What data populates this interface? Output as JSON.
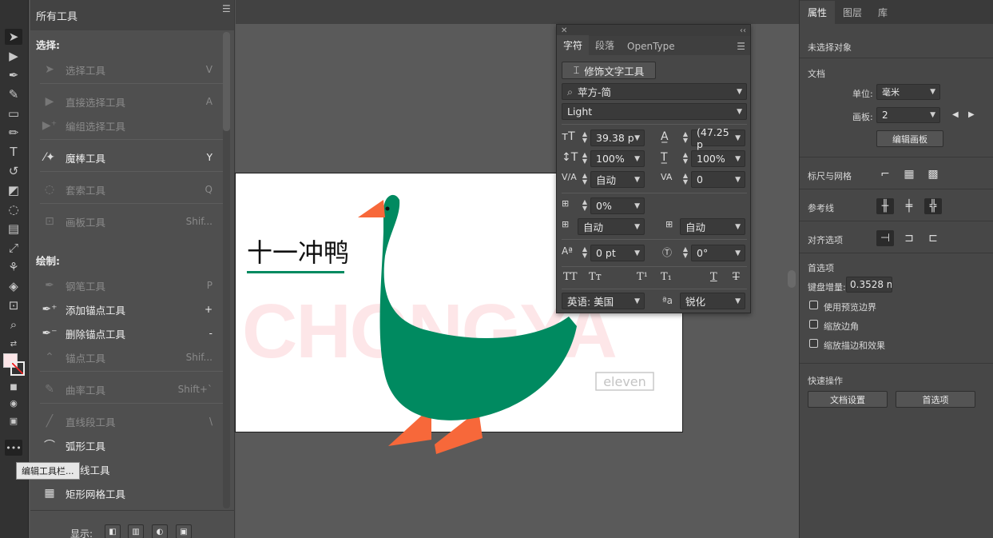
{
  "all_tools": {
    "title": "所有工具",
    "sections": {
      "select": "选择:",
      "draw": "绘制:"
    },
    "select_items": [
      {
        "label": "选择工具",
        "shortcut": "V",
        "icon": "arrow-icon"
      },
      {
        "label": "直接选择工具",
        "shortcut": "A",
        "icon": "direct-select-icon"
      },
      {
        "label": "编组选择工具",
        "shortcut": "",
        "icon": "group-select-icon"
      },
      {
        "label": "魔棒工具",
        "shortcut": "Y",
        "icon": "magic-wand-icon"
      },
      {
        "label": "套索工具",
        "shortcut": "Q",
        "icon": "lasso-icon"
      },
      {
        "label": "画板工具",
        "shortcut": "Shif...",
        "icon": "artboard-icon"
      }
    ],
    "draw_items": [
      {
        "label": "钢笔工具",
        "shortcut": "P",
        "icon": "pen-icon"
      },
      {
        "label": "添加锚点工具",
        "shortcut": "+",
        "icon": "add-anchor-icon"
      },
      {
        "label": "删除锚点工具",
        "shortcut": "-",
        "icon": "delete-anchor-icon"
      },
      {
        "label": "锚点工具",
        "shortcut": "Shif...",
        "icon": "anchor-icon"
      },
      {
        "label": "曲率工具",
        "shortcut": "Shift+`",
        "icon": "curvature-icon"
      },
      {
        "label": "直线段工具",
        "shortcut": "\\",
        "icon": "line-icon"
      },
      {
        "label": "弧形工具",
        "shortcut": "",
        "icon": "arc-icon"
      },
      {
        "label": "线工具",
        "shortcut": "",
        "icon": "spiral-icon"
      },
      {
        "label": "矩形网格工具",
        "shortcut": "",
        "icon": "grid-icon"
      }
    ],
    "display_label": "显示:",
    "tooltip": "编辑工具栏..."
  },
  "artboard": {
    "title": "十一冲鸭",
    "bg_text": "CHONGYA",
    "badge": "eleven"
  },
  "character_panel": {
    "tabs": [
      "字符",
      "段落",
      "OpenType"
    ],
    "touch_type_button": "修饰文字工具",
    "font_family": "苹方-简",
    "font_style": "Light",
    "font_size": "39.38 p",
    "leading": "(47.25 p",
    "vertical_scale": "100%",
    "horizontal_scale": "100%",
    "kerning": "自动",
    "tracking": "0",
    "tsume": "0%",
    "aki_left": "自动",
    "aki_right": "自动",
    "baseline_shift": "0 pt",
    "rotation": "0°",
    "style_buttons": [
      "TT",
      "Tт",
      "T¹",
      "T₁",
      "T",
      "T"
    ],
    "language": "英语: 美国",
    "anti_alias_label": "ªa",
    "anti_alias": "锐化"
  },
  "properties": {
    "tabs": [
      "属性",
      "图层",
      "库"
    ],
    "no_selection": "未选择对象",
    "document": "文档",
    "units_label": "单位:",
    "units_value": "毫米",
    "artboard_label": "画板:",
    "artboard_value": "2",
    "edit_artboards": "编辑画板",
    "rulers_grids": "标尺与网格",
    "guides": "参考线",
    "align_options": "对齐选项",
    "preferences": "首选项",
    "keyboard_increment_label": "键盘增量:",
    "keyboard_increment_value": "0.3528 m",
    "checkboxes": [
      "使用预览边界",
      "缩放边角",
      "缩放描边和效果"
    ],
    "quick_actions": "快速操作",
    "doc_setup_button": "文档设置",
    "prefs_button": "首选项"
  },
  "colors": {
    "duck_green": "#008a60",
    "duck_orange": "#f7683a",
    "bg_text_pink": "#fde6e8",
    "ui_dark": "#323232"
  }
}
